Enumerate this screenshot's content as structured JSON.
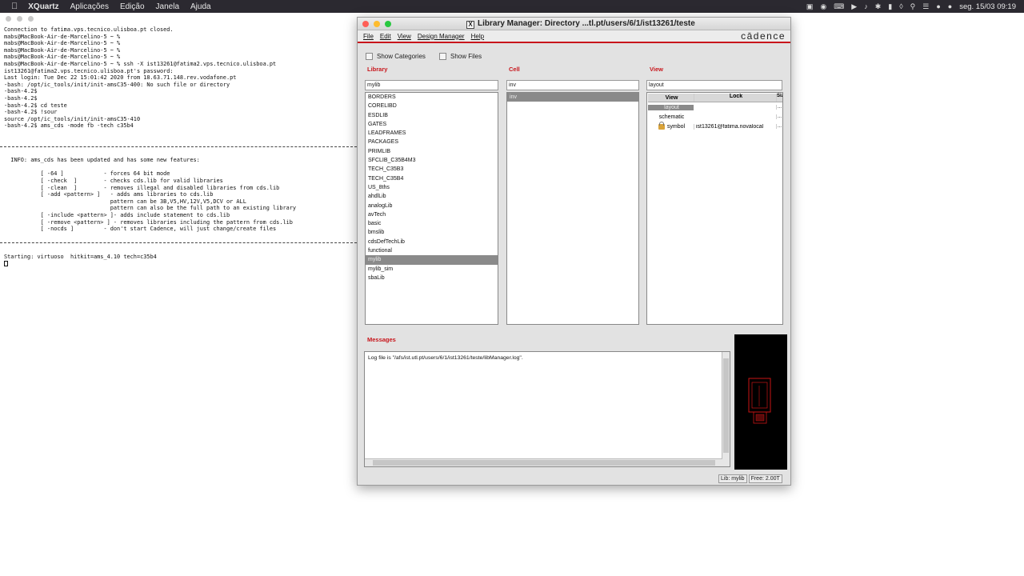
{
  "mac_menubar": {
    "apple": "",
    "app_name": "XQuartz",
    "items": [
      "Aplicações",
      "Edição",
      "Janela",
      "Ajuda"
    ],
    "clock": "seg. 15/03  09:19"
  },
  "terminal": {
    "lines": [
      "Connection to fatima.vps.tecnico.ulisboa.pt closed.",
      "mabs@MacBook-Air-de-Marcelino-5 ~ %",
      "mabs@MacBook-Air-de-Marcelino-5 ~ %",
      "mabs@MacBook-Air-de-Marcelino-5 ~ %",
      "mabs@MacBook-Air-de-Marcelino-5 ~ %",
      "mabs@MacBook-Air-de-Marcelino-5 ~ % ssh -X ist13261@fatima2.vps.tecnico.ulisboa.pt",
      "ist13261@fatima2.vps.tecnico.ulisboa.pt's password:",
      "Last login: Tue Dec 22 15:01:42 2020 from 18.63.71.148.rev.vodafone.pt",
      "-bash: /opt/ic_tools/init/init-amsC35-400: No such file or directory",
      "-bash-4.2$",
      "-bash-4.2$",
      "-bash-4.2$ cd teste",
      "-bash-4.2$ !sour",
      "source /opt/ic_tools/init/init-amsC35-410",
      "-bash-4.2$ ams_cds -mode fb -tech c35b4",
      "",
      "",
      "---",
      "",
      "  INFO: ams_cds has been updated and has some new features:",
      "",
      "           [ -64 ]            - forces 64 bit mode",
      "           [ -check  ]        - checks cds.lib for valid libraries",
      "           [ -clean  ]        - removes illegal and disabled libraries from cds.lib",
      "           [ -add <pattern> ]   - adds ams libraries to cds.lib",
      "                                pattern can be 3B,V5,HV,12V,V5,DCV or ALL",
      "                                pattern can also be the full path to an existing library",
      "           [ -include <pattern> ]- adds include statement to cds.lib",
      "           [ -remove <pattern> ] - removes libraries including the pattern from cds.lib",
      "           [ -nocds ]         - don't start Cadence, will just change/create files",
      "",
      "---",
      "",
      "Starting: virtuoso  hitkit=ams_4.10 tech=c35b4"
    ]
  },
  "library_manager": {
    "title": "Library Manager: Directory ...tl.pt/users/6/1/ist13261/teste",
    "menus": [
      "File",
      "Edit",
      "View",
      "Design Manager",
      "Help"
    ],
    "logo": "cādence",
    "show_categories": "Show Categories",
    "show_files": "Show Files",
    "library": {
      "label": "Library",
      "filter": "mylib",
      "items": [
        "BORDERS",
        "CORELIBD",
        "ESDLIB",
        "GATES",
        "LEADFRAMES",
        "PACKAGES",
        "PRIMLIB",
        "SFCLIB_C35B4M3",
        "TECH_C35B3",
        "TECH_C35B4",
        "US_8ths",
        "ahdlLib",
        "analogLib",
        "avTech",
        "basic",
        "bmslib",
        "cdsDefTechLib",
        "functional",
        "mylib",
        "mylib_sim",
        "sbaLib"
      ],
      "selected": "mylib"
    },
    "cell": {
      "label": "Cell",
      "filter": "inv",
      "items": [
        "inv"
      ],
      "selected": "inv"
    },
    "view": {
      "label": "View",
      "filter": "layout",
      "columns": [
        "View",
        "Lock",
        "Siz"
      ],
      "rows": [
        {
          "view": "layout",
          "lock": "",
          "size": "...",
          "icon": ""
        },
        {
          "view": "schematic",
          "lock": "",
          "size": "...",
          "icon": ""
        },
        {
          "view": "symbol",
          "lock": "ist13261@fatima.novalocal",
          "size": "...",
          "icon": "lock-icon"
        }
      ],
      "selected": "layout"
    },
    "messages": {
      "label": "Messages",
      "text": "Log file is \"/afs/ist.utl.pt/users/6/1/ist13261/teste/libManager.log\"."
    },
    "status": {
      "lib": "Lib: mylib",
      "free": "Free: 2.00T"
    }
  }
}
